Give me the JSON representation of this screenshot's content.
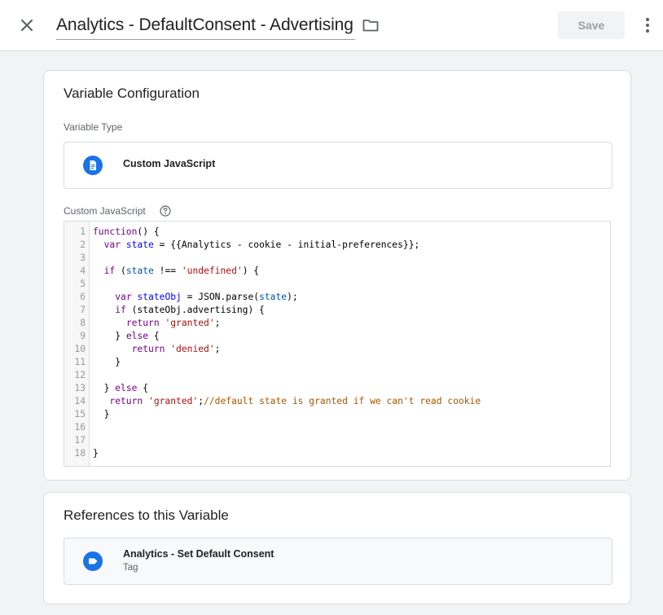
{
  "header": {
    "title": "Analytics - DefaultConsent - Advertising",
    "save_label": "Save",
    "close_icon": "close-icon",
    "folder_icon": "folder-icon",
    "more_icon": "more-vert-icon"
  },
  "config": {
    "title": "Variable Configuration",
    "variable_type_label": "Variable Type",
    "variable_type_value": "Custom JavaScript",
    "variable_type_icon": "document-icon",
    "code_label": "Custom JavaScript",
    "help_icon": "help-icon"
  },
  "code_lines": [
    {
      "n": "1",
      "parts": [
        [
          "kw",
          "function"
        ],
        [
          "",
          "() {"
        ]
      ]
    },
    {
      "n": "2",
      "parts": [
        [
          "",
          "  "
        ],
        [
          "kw",
          "var"
        ],
        [
          "",
          " "
        ],
        [
          "def",
          "state"
        ],
        [
          "",
          " = {{Analytics - cookie - initial-preferences}};"
        ]
      ]
    },
    {
      "n": "3",
      "parts": []
    },
    {
      "n": "4",
      "parts": [
        [
          "",
          "  "
        ],
        [
          "kw",
          "if"
        ],
        [
          "",
          " ("
        ],
        [
          "var",
          "state"
        ],
        [
          "",
          " !== "
        ],
        [
          "str",
          "'undefined'"
        ],
        [
          "",
          ") {"
        ]
      ]
    },
    {
      "n": "5",
      "parts": []
    },
    {
      "n": "6",
      "parts": [
        [
          "",
          "    "
        ],
        [
          "kw",
          "var"
        ],
        [
          "",
          " "
        ],
        [
          "def",
          "stateObj"
        ],
        [
          "",
          " = JSON.parse("
        ],
        [
          "var",
          "state"
        ],
        [
          "",
          ");"
        ]
      ]
    },
    {
      "n": "7",
      "parts": [
        [
          "",
          "    "
        ],
        [
          "kw",
          "if"
        ],
        [
          "",
          " (stateObj.advertising) {"
        ]
      ]
    },
    {
      "n": "8",
      "parts": [
        [
          "",
          "      "
        ],
        [
          "kw",
          "return"
        ],
        [
          "",
          " "
        ],
        [
          "str",
          "'granted'"
        ],
        [
          "",
          ";"
        ]
      ]
    },
    {
      "n": "9",
      "parts": [
        [
          "",
          "    } "
        ],
        [
          "kw",
          "else"
        ],
        [
          "",
          " {"
        ]
      ]
    },
    {
      "n": "10",
      "parts": [
        [
          "",
          "       "
        ],
        [
          "kw",
          "return"
        ],
        [
          "",
          " "
        ],
        [
          "str",
          "'denied'"
        ],
        [
          "",
          ";"
        ]
      ]
    },
    {
      "n": "11",
      "parts": [
        [
          "",
          "    }"
        ]
      ]
    },
    {
      "n": "12",
      "parts": []
    },
    {
      "n": "13",
      "parts": [
        [
          "",
          "  } "
        ],
        [
          "kw",
          "else"
        ],
        [
          "",
          " {"
        ]
      ]
    },
    {
      "n": "14",
      "parts": [
        [
          "",
          "   "
        ],
        [
          "kw",
          "return"
        ],
        [
          "",
          " "
        ],
        [
          "str",
          "'granted'"
        ],
        [
          "",
          ";"
        ],
        [
          "cmt",
          "//default state is granted if we can't read cookie"
        ]
      ]
    },
    {
      "n": "15",
      "parts": [
        [
          "",
          "  }"
        ]
      ]
    },
    {
      "n": "16",
      "parts": []
    },
    {
      "n": "17",
      "parts": []
    },
    {
      "n": "18",
      "parts": [
        [
          "",
          "}"
        ]
      ]
    }
  ],
  "references": {
    "title": "References to this Variable",
    "items": [
      {
        "name": "Analytics - Set Default Consent",
        "type": "Tag",
        "icon": "tag-icon"
      }
    ]
  },
  "colors": {
    "accent_blue": "#1a73e8",
    "disabled_text": "#9aa0a6",
    "page_bg": "#f1f3f4"
  }
}
